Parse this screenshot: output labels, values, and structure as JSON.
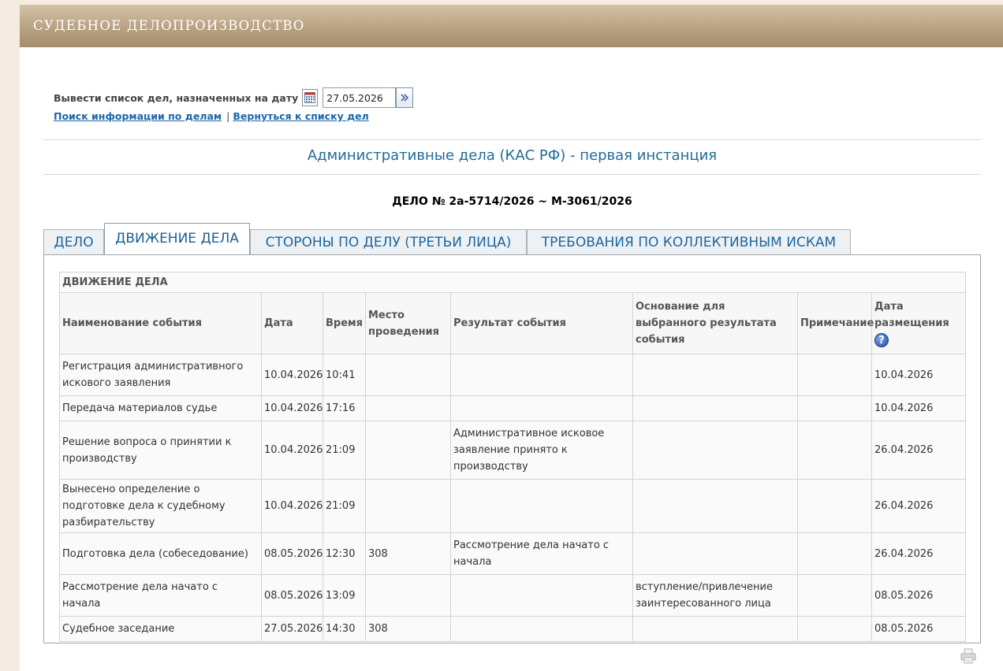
{
  "header": {
    "title": "СУДЕБНОЕ ДЕЛОПРОИЗВОДСТВО"
  },
  "date_filter": {
    "label": "Вывести список дел, назначенных на дату",
    "value": "27.05.2026",
    "icon": "calendar-icon",
    "go_icon": "go-arrow-icon"
  },
  "links": {
    "search": "Поиск информации по делам",
    "separator": "|",
    "back": "Вернуться к списку дел"
  },
  "section_title": "Административные дела (КАС РФ) - первая инстанция",
  "case_number": "ДЕЛО № 2а-5714/2026 ~ М-3061/2026",
  "tabs": [
    {
      "label": "ДЕЛО",
      "active": false
    },
    {
      "label": "ДВИЖЕНИЕ ДЕЛА",
      "active": true
    },
    {
      "label": "СТОРОНЫ ПО ДЕЛУ (ТРЕТЬИ ЛИЦА)",
      "active": false
    },
    {
      "label": "ТРЕБОВАНИЯ ПО КОЛЛЕКТИВНЫМ ИСКАМ",
      "active": false
    }
  ],
  "table": {
    "caption": "ДВИЖЕНИЕ ДЕЛА",
    "headers": {
      "name": "Наименование события",
      "date": "Дата",
      "time": "Время",
      "place": "Место проведения",
      "result": "Результат события",
      "basis": "Основание для выбранного результата события",
      "note": "Примечание",
      "posted": "Дата размещения"
    },
    "help_icon_glyph": "?",
    "rows": [
      {
        "name": "Регистрация административного искового заявления",
        "date": "10.04.2026",
        "time": "10:41",
        "place": "",
        "result": "",
        "basis": "",
        "note": "",
        "posted": "10.04.2026"
      },
      {
        "name": "Передача материалов судье",
        "date": "10.04.2026",
        "time": "17:16",
        "place": "",
        "result": "",
        "basis": "",
        "note": "",
        "posted": "10.04.2026"
      },
      {
        "name": "Решение вопроса о принятии к производству",
        "date": "10.04.2026",
        "time": "21:09",
        "place": "",
        "result": "Административное исковое заявление принято к производству",
        "basis": "",
        "note": "",
        "posted": "26.04.2026"
      },
      {
        "name": "Вынесено определение о подготовке дела к судебному разбирательству",
        "date": "10.04.2026",
        "time": "21:09",
        "place": "",
        "result": "",
        "basis": "",
        "note": "",
        "posted": "26.04.2026"
      },
      {
        "name": "Подготовка дела (собеседование)",
        "date": "08.05.2026",
        "time": "12:30",
        "place": "308",
        "result": "Рассмотрение дела начато с начала",
        "basis": "",
        "note": "",
        "posted": "26.04.2026"
      },
      {
        "name": "Рассмотрение дела начато с начала",
        "date": "08.05.2026",
        "time": "13:09",
        "place": "",
        "result": "",
        "basis": "вступление/привлечение заинтересованного лица",
        "note": "",
        "posted": "08.05.2026"
      },
      {
        "name": "Судебное заседание",
        "date": "27.05.2026",
        "time": "14:30",
        "place": "308",
        "result": "",
        "basis": "",
        "note": "",
        "posted": "08.05.2026"
      }
    ]
  },
  "print_icon": "printer-icon",
  "colors": {
    "header": "#b9a281",
    "accent": "#1f6b96",
    "link": "#1e66a8",
    "page_bg": "#f4ebe3"
  }
}
